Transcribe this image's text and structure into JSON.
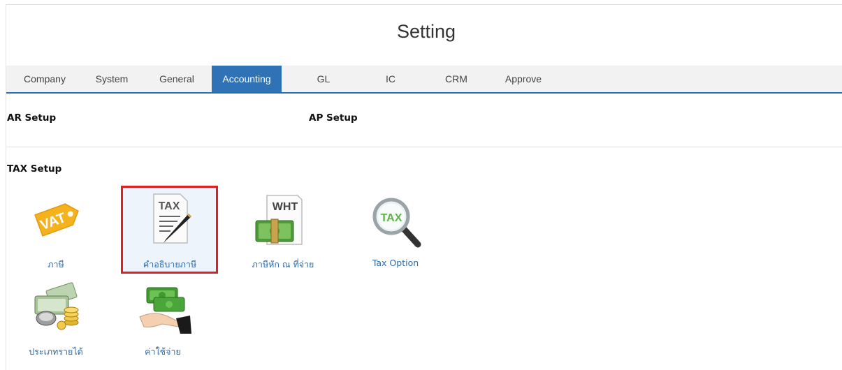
{
  "page": {
    "title": "Setting"
  },
  "tabs": [
    {
      "label": "Company"
    },
    {
      "label": "System"
    },
    {
      "label": "General"
    },
    {
      "label": "Accounting"
    },
    {
      "label": "GL"
    },
    {
      "label": "IC"
    },
    {
      "label": "CRM"
    },
    {
      "label": "Approve"
    }
  ],
  "active_tab": "Accounting",
  "sections": {
    "ar_setup": "AR Setup",
    "ap_setup": "AP Setup",
    "tax_setup": "TAX Setup"
  },
  "tax_items": [
    {
      "label": "ภาษี",
      "icon": "vat-tag-icon",
      "icon_text": "VAT"
    },
    {
      "label": "คำอธิบายภาษี",
      "icon": "tax-document-pen-icon",
      "icon_text": "TAX"
    },
    {
      "label": "ภาษีหัก ณ ที่จ่าย",
      "icon": "wht-money-icon",
      "icon_text": "WHT"
    },
    {
      "label": "Tax Option",
      "icon": "tax-magnifier-icon",
      "icon_text": "TAX"
    },
    {
      "label": "ประเภทรายได้",
      "icon": "income-money-coins-icon"
    },
    {
      "label": "ค่าใช้จ่าย",
      "icon": "expense-hand-money-icon"
    }
  ],
  "colors": {
    "accent": "#2f73b6",
    "link": "#2f6aa8",
    "highlight_border": "#e02020"
  }
}
